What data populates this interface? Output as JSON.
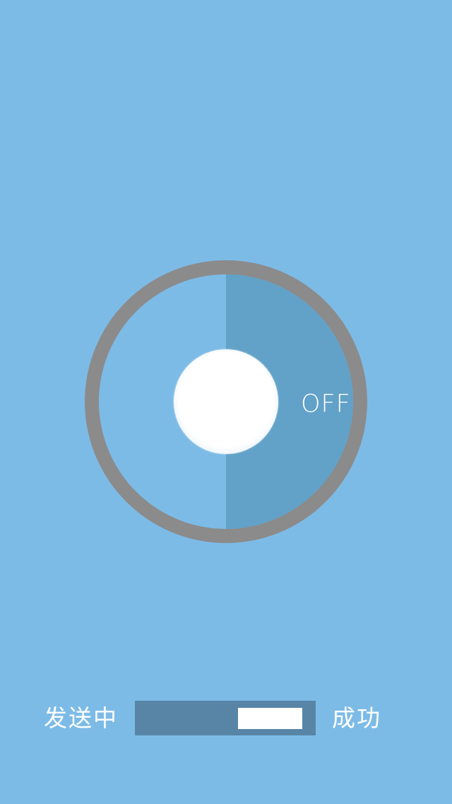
{
  "dial": {
    "state_label": "OFF",
    "colors": {
      "background": "#7dbbe7",
      "ring": "#8b8b8b",
      "active_half": "#62a1c8",
      "knob": "#ffffff"
    }
  },
  "progress": {
    "left_label": "发送中",
    "right_label": "成功",
    "value": 0.95,
    "colors": {
      "track": "#5885a6",
      "thumb": "#ffffff"
    }
  }
}
